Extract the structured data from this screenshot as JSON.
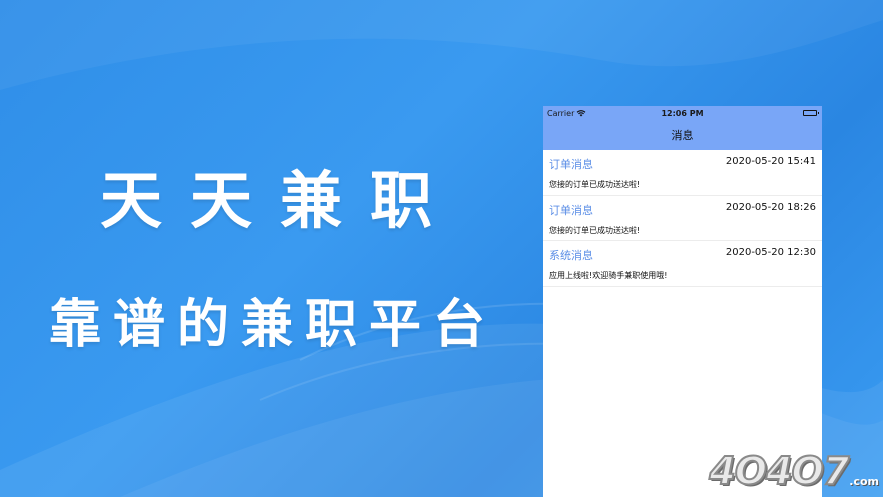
{
  "promo": {
    "headline": "天天兼职",
    "subheadline": "靠谱的兼职平台"
  },
  "phone": {
    "status_bar": {
      "carrier": "Carrier",
      "time": "12:06 PM",
      "icons": [
        "wifi-icon",
        "battery-icon"
      ]
    },
    "nav_title": "消息",
    "messages": [
      {
        "type": "订单消息",
        "date": "2020-05-20 15:41",
        "body": "您接的订单已成功送达啦!"
      },
      {
        "type": "订单消息",
        "date": "2020-05-20 18:26",
        "body": "您接的订单已成功送达啦!"
      },
      {
        "type": "系统消息",
        "date": "2020-05-20 12:30",
        "body": "应用上线啦!欢迎骑手兼职使用哦!"
      }
    ]
  },
  "watermark": {
    "digits": "4O4O7",
    "suffix": ".com"
  },
  "colors": {
    "background": "#2f8ee8",
    "nav_bar": "#79a6f7",
    "message_type": "#5b8ee6"
  }
}
